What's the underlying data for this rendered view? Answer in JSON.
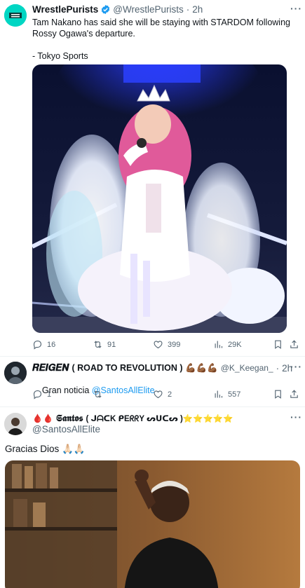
{
  "tweet1": {
    "display_name": "WrestlePurists",
    "handle": "@WrestlePurists",
    "separator": "·",
    "time": "2h",
    "more": "···",
    "text": "Tam Nakano has said she will be staying with STARDOM following Rossy Ogawa's departure.\n\n- Tokyo Sports",
    "avatar_text": "WRESTLE PURISTS",
    "stats": {
      "replies": "16",
      "reposts": "91",
      "likes": "399",
      "views": "29K"
    }
  },
  "tweet2": {
    "display_name": "𝑹𝑬𝑰𝑮𝑬𝑵",
    "display_name_suffix": "( ROAD TO REVOLUTION ) 💪🏾💪🏾💪🏾",
    "handle": "@K_Keegan_",
    "separator": "·",
    "time": "2h",
    "more": "···",
    "text_prefix": "Gran noticia ",
    "mention": "@SantosAllElite",
    "stats": {
      "replies": "1",
      "reposts": "",
      "likes": "2",
      "views": "557"
    }
  },
  "tweet3": {
    "display_name_prefix": "🩸🩸",
    "display_name": "𝕾𝖆𝖓𝖙𝖔𝖘",
    "display_name_suffix": "( ᒍᗩᑕK ᑭEᖇᖇY ᔕᑌᑕᔕ )⭐⭐⭐⭐⭐",
    "handle": "@SantosAllElite",
    "more": "···",
    "text": "Gracias Dios 🙏🏻🙏🏻"
  },
  "colors": {
    "accent": "#1d9bf0",
    "muted": "#536471",
    "text": "#0f1419",
    "verified": "#1d9bf0",
    "purists_green": "#00d6c3"
  }
}
